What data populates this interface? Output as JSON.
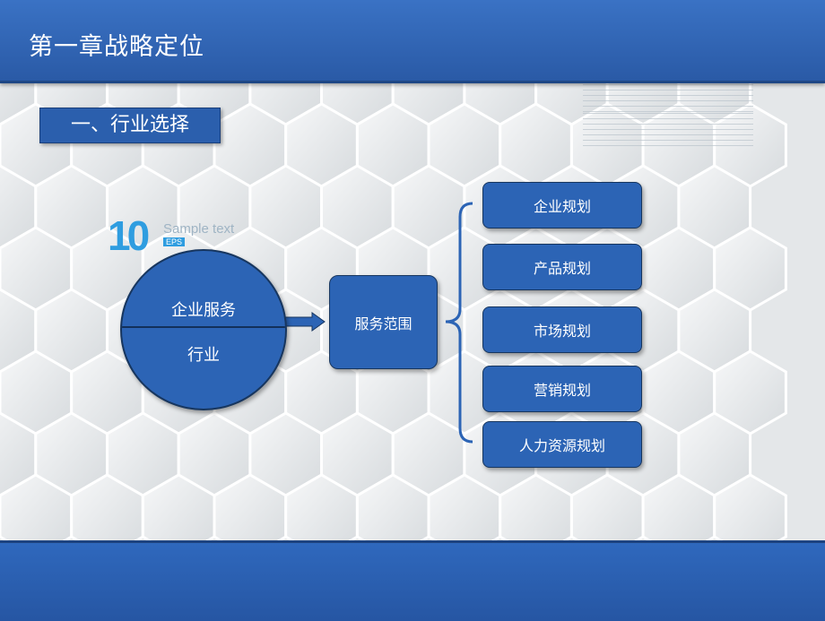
{
  "slide": {
    "title": "第一章战略定位",
    "section_title": "一、行业选择"
  },
  "logo": {
    "number": "10",
    "sample": "Sample text",
    "eps": "EPS"
  },
  "diagram": {
    "circle_top": "企业服务",
    "circle_bottom": "行业",
    "middle": "服务范围",
    "items": [
      "企业规划",
      "产品规划",
      "市场规划",
      "营销规划",
      "人力资源规划"
    ]
  },
  "colors": {
    "header": "#2f68bd",
    "box": "#2c64b5",
    "accent": "#2f9de0"
  }
}
